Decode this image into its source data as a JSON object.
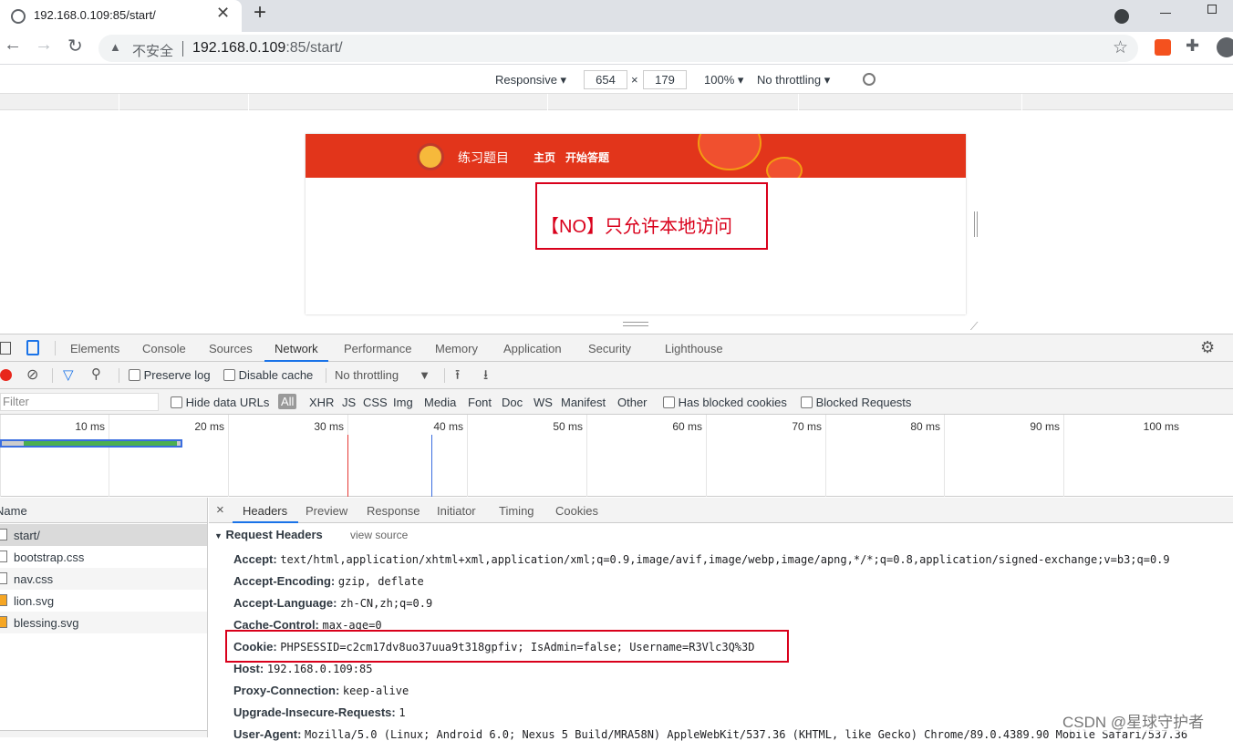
{
  "browser": {
    "tab_title": "192.168.0.109:85/start/",
    "new_tab_symbol": "+",
    "not_secure_label": "不安全",
    "url_host": "192.168.0.109",
    "url_rest": ":85/start/"
  },
  "device_toolbar": {
    "device": "Responsive",
    "width": "654",
    "height": "179",
    "zoom": "100%",
    "throttling": "No throttling"
  },
  "page": {
    "site_title": "练习题目",
    "nav_home": "主页",
    "nav_start": "开始答题",
    "message": "【NO】只允许本地访问"
  },
  "devtools": {
    "tabs": [
      "Elements",
      "Console",
      "Sources",
      "Network",
      "Performance",
      "Memory",
      "Application",
      "Security",
      "Lighthouse"
    ],
    "active_tab": "Network",
    "preserve_log": "Preserve log",
    "disable_cache": "Disable cache",
    "throttling": "No throttling",
    "filter_placeholder": "Filter",
    "hide_data_urls": "Hide data URLs",
    "type_filters": [
      "All",
      "XHR",
      "JS",
      "CSS",
      "Img",
      "Media",
      "Font",
      "Doc",
      "WS",
      "Manifest",
      "Other"
    ],
    "has_blocked_cookies": "Has blocked cookies",
    "blocked_requests": "Blocked Requests",
    "timeline_ticks": [
      "10 ms",
      "20 ms",
      "30 ms",
      "40 ms",
      "50 ms",
      "60 ms",
      "70 ms",
      "80 ms",
      "90 ms",
      "100 ms"
    ],
    "name_header": "Name",
    "requests": [
      "start/",
      "bootstrap.css",
      "nav.css",
      "lion.svg",
      "blessing.svg"
    ],
    "detail_tabs": [
      "Headers",
      "Preview",
      "Response",
      "Initiator",
      "Timing",
      "Cookies"
    ],
    "close_symbol": "×",
    "request_headers_title": "Request Headers",
    "view_source": "view source",
    "headers": [
      {
        "name": "Accept:",
        "value": "text/html,application/xhtml+xml,application/xml;q=0.9,image/avif,image/webp,image/apng,*/*;q=0.8,application/signed-exchange;v=b3;q=0.9"
      },
      {
        "name": "Accept-Encoding:",
        "value": "gzip, deflate"
      },
      {
        "name": "Accept-Language:",
        "value": "zh-CN,zh;q=0.9"
      },
      {
        "name": "Cache-Control:",
        "value": "max-age=0"
      },
      {
        "name": "Cookie:",
        "value": "PHPSESSID=c2cm17dv8uo37uua9t318gpfiv; IsAdmin=false; Username=R3Vlc3Q%3D"
      },
      {
        "name": "Host:",
        "value": "192.168.0.109:85"
      },
      {
        "name": "Proxy-Connection:",
        "value": "keep-alive"
      },
      {
        "name": "Upgrade-Insecure-Requests:",
        "value": "1"
      },
      {
        "name": "User-Agent:",
        "value": "Mozilla/5.0 (Linux; Android 6.0; Nexus 5 Build/MRA58N) AppleWebKit/537.36 (KHTML, like Gecko) Chrome/89.0.4389.90 Mobile Safari/537.36"
      }
    ]
  },
  "watermark": "CSDN @星球守护者",
  "colors": {
    "accent": "#1a73e8",
    "nav_red": "#e2351b",
    "highlight_box": "#d9001b"
  }
}
